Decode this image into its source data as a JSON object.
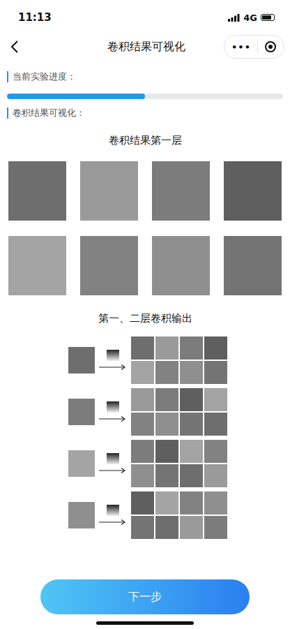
{
  "status_bar": {
    "time": "11:13",
    "network": "4G",
    "battery_level": 0.8
  },
  "nav": {
    "title": "卷积结果可视化",
    "menu": "•••"
  },
  "progress": {
    "label": "当前实验进度：",
    "level": 0.5
  },
  "visualization": {
    "label": "卷积结果可视化：",
    "first_layer": {
      "title": "卷积结果第一层"
    },
    "layer_outputs": {
      "title": "第一、二层卷积输出"
    }
  },
  "next_button": {
    "label": "下一步"
  }
}
